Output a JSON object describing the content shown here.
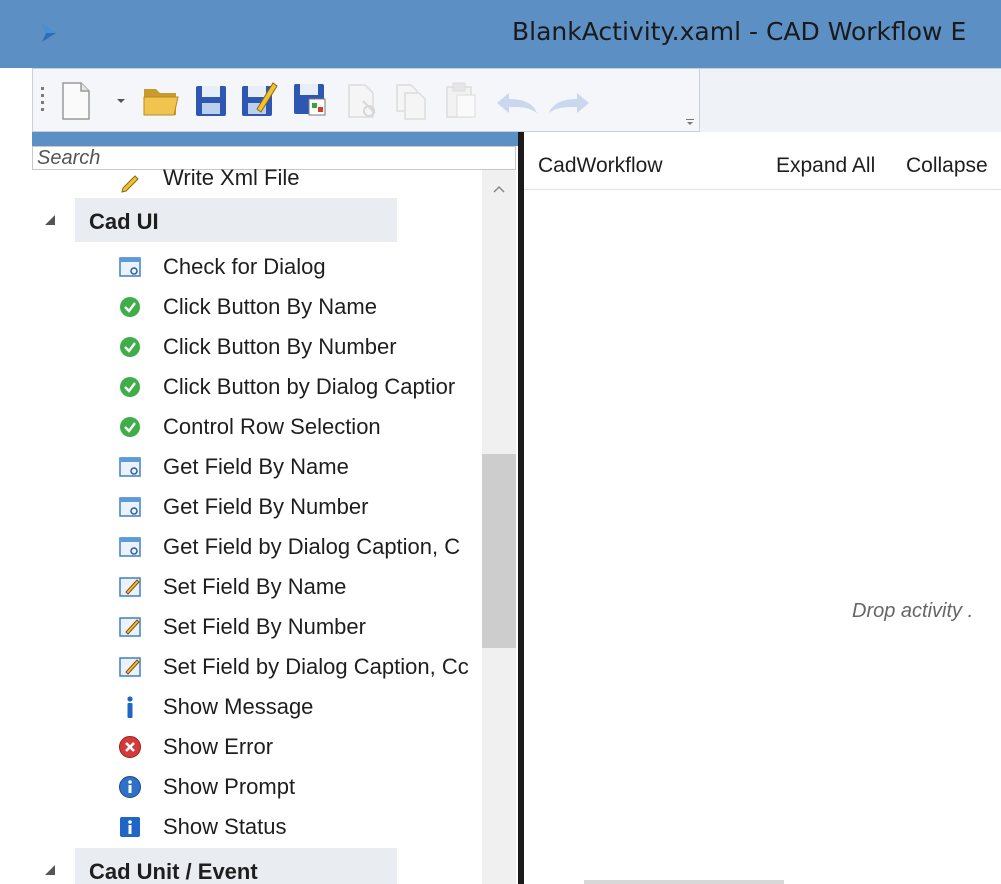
{
  "window": {
    "title": "BlankActivity.xaml - CAD Workflow E"
  },
  "toolbar": {
    "items": [
      {
        "name": "new-document-icon",
        "enabled": true
      },
      {
        "name": "dropdown-arrow-icon",
        "enabled": true
      },
      {
        "name": "open-folder-icon",
        "enabled": true
      },
      {
        "name": "save-icon",
        "enabled": true
      },
      {
        "name": "save-as-icon",
        "enabled": true
      },
      {
        "name": "save-all-icon",
        "enabled": true
      },
      {
        "name": "cut-icon",
        "enabled": false
      },
      {
        "name": "copy-icon",
        "enabled": false
      },
      {
        "name": "paste-icon",
        "enabled": false
      },
      {
        "name": "undo-icon",
        "enabled": false
      },
      {
        "name": "redo-icon",
        "enabled": false
      }
    ]
  },
  "toolbox": {
    "search_placeholder": "Search",
    "partial_item": {
      "label": "Write Xml File",
      "icon": "pencil-icon"
    },
    "categories": [
      {
        "label": "Cad UI",
        "items": [
          {
            "label": "Check for Dialog",
            "icon": "dialog-window-icon"
          },
          {
            "label": "Click Button By Name",
            "icon": "green-check-icon"
          },
          {
            "label": "Click Button By Number",
            "icon": "green-check-icon"
          },
          {
            "label": "Click Button by Dialog Captior",
            "icon": "green-check-icon"
          },
          {
            "label": "Control Row Selection",
            "icon": "green-check-icon"
          },
          {
            "label": "Get Field By Name",
            "icon": "dialog-window-icon"
          },
          {
            "label": "Get Field By Number",
            "icon": "dialog-window-icon"
          },
          {
            "label": "Get Field by Dialog Caption, C",
            "icon": "dialog-window-icon"
          },
          {
            "label": "Set Field By Name",
            "icon": "edit-field-icon"
          },
          {
            "label": "Set Field By Number",
            "icon": "edit-field-icon"
          },
          {
            "label": "Set Field by Dialog Caption, Cc",
            "icon": "edit-field-icon"
          },
          {
            "label": "Show Message",
            "icon": "info-i-icon"
          },
          {
            "label": "Show Error",
            "icon": "error-x-icon"
          },
          {
            "label": "Show Prompt",
            "icon": "info-circle-icon"
          },
          {
            "label": "Show Status",
            "icon": "info-square-icon"
          }
        ]
      },
      {
        "label": "Cad Unit / Event",
        "items": []
      }
    ]
  },
  "designer": {
    "breadcrumb": "CadWorkflow",
    "expand_all": "Expand All",
    "collapse_all": "Collapse",
    "drop_hint": "Drop activity ."
  }
}
